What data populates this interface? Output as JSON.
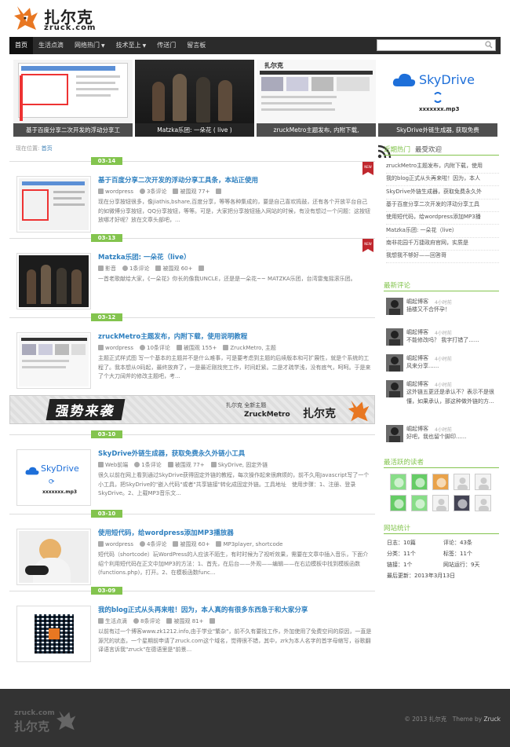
{
  "header": {
    "logo_cn": "扎尔克",
    "logo_en": "zruck.com"
  },
  "nav": {
    "items": [
      {
        "label": "首页",
        "active": true,
        "caret": false
      },
      {
        "label": "生活点滴",
        "active": false,
        "caret": false
      },
      {
        "label": "网络热门",
        "active": false,
        "caret": true
      },
      {
        "label": "技术至上",
        "active": false,
        "caret": true
      },
      {
        "label": "传送门",
        "active": false,
        "caret": false
      },
      {
        "label": "留言板",
        "active": false,
        "caret": false
      }
    ],
    "search_placeholder": ""
  },
  "slider": [
    {
      "caption": "基于百度分享二次开发的浮动分享工",
      "thumb_text": "当前的 js 文件, 拖入二 次开放, 既可在 CSS/JS 是你所有的代码需要实现代码总数不超过 34"
    },
    {
      "caption": "Matzka乐团: 一朵花 ( live )"
    },
    {
      "caption": "zruckMetro主题发布, 内附下载,",
      "thumb_logo": "扎尔克"
    },
    {
      "caption": "SkyDrive外链生成器, 获取免费",
      "thumb_brand": "SkyDrive",
      "thumb_file": "xxxxxxx.mp3"
    }
  ],
  "breadcrumb": {
    "label": "现在位置:",
    "link": "首页"
  },
  "posts": [
    {
      "date": "03-14",
      "title": "基于百度分享二次开发的浮动分享工具条，本站正使用",
      "category": "wordpress",
      "comments": "3条评论",
      "views": "被围观 77+",
      "tags": "",
      "excerpt": "现在分享按钮很多，像jiathis,bshare,百度分享，等等各种集成的，要是自己喜欢捣鼓，还有各个开放平台自己的如微博分享按钮，QQ分享按钮，等等。可是，大家把分享按钮插入网站的时候，有没有想过一个问题：这按钮放哪才好呢？放在文章头部吧，...",
      "ribbon": true
    },
    {
      "date": "03-13",
      "title": "Matzka乐团: 一朵花（live）",
      "category": "影音",
      "comments": "1条评论",
      "views": "被围观 60+",
      "tags": "",
      "excerpt": "一首老歌献给大家，《一朵花》你长的像我UNCLE，还是是一朵花~~ MATZKA乐团，台湾雷鬼摇滚乐团。",
      "ribbon": true
    },
    {
      "date": "03-12",
      "title": "zruckMetro主题发布，内附下载，使用说明教程",
      "category": "wordpress",
      "comments": "10条评论",
      "views": "被围观 155+",
      "tags": "ZruckMetro, 主题",
      "excerpt": "主题正式样式图 写一个基本的主题并不是什么难事，可是要考虑到主题的后续版本和可扩展性，就是个系统的工程了。我本想从0码起，最终放弃了，一是最近刚找完工作，时间赶紧。二是才疏学浅，没有底气，呵呵。于是来了个大刀阔斧的修改主题吧，考...",
      "ribbon": false
    },
    {
      "date": "03-10",
      "title": "SkyDrive外链生成器，获取免费永久外链小工具",
      "category": "Web前端",
      "comments": "1条评论",
      "views": "被围观 77+",
      "tags": "SkyDrive, 固定外链",
      "excerpt": "很久以前在网上看到通过SkyDrive获得固定外链的教程，每次操作起来很麻烦的，前不久用Javascript写了一个小工具，把SkyDrive的\"嵌入代码\"或者\"共享链接\"转化成固定外链。工具地址　使用步骤：1、注册、登录SkyDrive。2、上载MP3音乐文...",
      "ribbon": false
    },
    {
      "date": "03-10",
      "title": "使用短代码，给wordpress添加MP3播放器",
      "category": "wordpress",
      "comments": "4条评论",
      "views": "被围观 60+",
      "tags": "MP3player, shortcode",
      "excerpt": "短代码（shortcode）玩WordPress的人应该不陌生，有时时候为了视听效果，需要在文章中插入音乐，下面介绍个利用短代码在正文中加MP3的方法：1、首先，在后台——外观——编辑——在右边模板中找到模板函数(functions.php)，打开。2、在模板函数func...",
      "ribbon": false
    },
    {
      "date": "03-09",
      "title": "我的blog正式从头再来啦！因为，本人真的有很多东西急于和大家分享",
      "category": "生活点滴",
      "comments": "8条评论",
      "views": "被围观 81+",
      "tags": "",
      "excerpt": "以前有过一个博客www.zk1212.info,由于学业\"繁杂\"，前不久有要找工作，外加使用了免费空间的原因，一直是源咒的状态，一个星期前申请了zruck.com这个域名，觉得很不错，其中，zrk为本人名字的首字母缩写，谷歌翻译语言诉我\"zruck\"在德语里是\"前景...",
      "ribbon": false
    }
  ],
  "banner": {
    "text1": "强势来袭",
    "text2": "扎尔克 全新主题",
    "text3": "ZruckMetro",
    "text4": "扎尔克"
  },
  "sidebar": {
    "recent_title": "近期热门",
    "recent_sub": "最受欢迎",
    "recent_items": [
      "zruckMetro主题发布，内附下载，使用",
      "我的blog正式从头再来啦！因为，本人",
      "SkyDrive外链生成器，获取免费永久外",
      "基于百度分享二次开发的浮动分享工具",
      "使用短代码，给wordpress添加MP3播",
      "Matzka乐团: 一朵花（live）",
      "南非花园千万捷政府官网，实质是",
      "我想我不够好——回答哥"
    ],
    "comments_title": "最新评论",
    "comments": [
      {
        "name": "崛起博客",
        "time": "4小时前",
        "text": "插楼又不合怀孕！"
      },
      {
        "name": "崛起博客",
        "time": "4小时前",
        "text": "不能修改吗？ 我字打错了......"
      },
      {
        "name": "崛起博客",
        "time": "4小时前",
        "text": "风来分享......"
      },
      {
        "name": "崛起博客",
        "time": "4小时前",
        "text": "这外链五更还是承认不？表示不是很懂，如果承认，那这种做外链的方..."
      },
      {
        "name": "崛起博客",
        "time": "4小时前",
        "text": "好吧，我也留个脚印......"
      }
    ],
    "readers_title": "最活跃的读者",
    "stats_title": "网站统计",
    "stats": {
      "days": "日志：10篇",
      "comments": "评论：43条",
      "categories": "分类：11个",
      "tags": "标签：11个",
      "links": "链接：1个",
      "runtime": "网站运行：9天",
      "updated": "最后更新：2013年3月13日"
    }
  },
  "footer": {
    "logo_en": "zruck.com",
    "logo_cn": "扎尔克",
    "copyright": "© 2013 扎尔克　Theme by ",
    "author": "Zruck"
  },
  "colors": {
    "accent": "#83c44e",
    "link": "#2d7fbf",
    "nav_bg": "#2b2b2b",
    "footer_bg": "#333333",
    "ribbon": "#c0282e"
  }
}
